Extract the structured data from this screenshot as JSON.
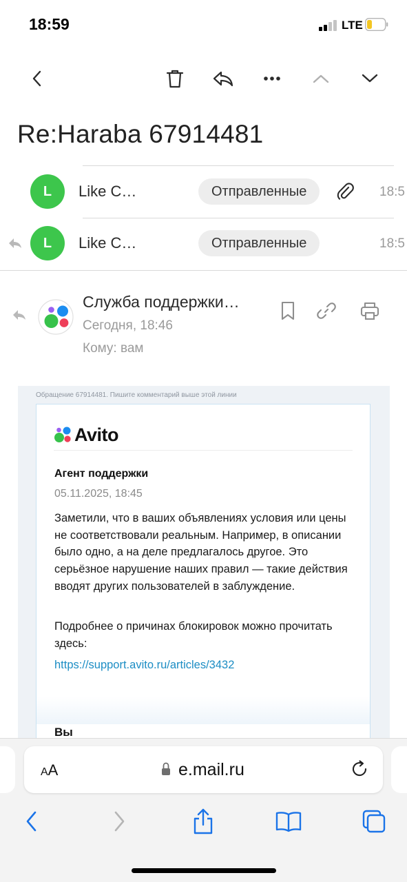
{
  "status_bar": {
    "time": "18:59",
    "network": "LTE",
    "battery_color": "#f3c623"
  },
  "toolbar": {
    "back_icon": "chevron-left-icon",
    "delete_icon": "trash-icon",
    "reply_icon": "reply-icon",
    "more_icon": "more-dots-icon",
    "prev_icon": "chevron-up-icon",
    "next_icon": "chevron-down-icon"
  },
  "email": {
    "subject": "Re:Haraba 67914481",
    "thread": [
      {
        "avatar_letter": "L",
        "name": "Like C…",
        "folder": "Отправленные",
        "time": "18:5",
        "has_attachment": true,
        "replied": false
      },
      {
        "avatar_letter": "L",
        "name": "Like C…",
        "folder": "Отправленные",
        "time": "18:5",
        "has_attachment": false,
        "replied": true
      }
    ],
    "open_message": {
      "sender": "Служба поддержки…",
      "date": "Сегодня, 18:46",
      "to": "Кому: вам",
      "actions": [
        "bookmark-icon",
        "link-icon",
        "print-icon"
      ]
    },
    "body": {
      "hint": "Обращение 67914481. Пишите комментарий выше этой линии",
      "logo_text": "Avito",
      "agent_label": "Агент поддержки",
      "message_date": "05.11.2025, 18:45",
      "paragraph1": "Заметили, что в ваших объявлениях условия или цены не соответствовали реальным. Например, в описании было одно, а на деле предлагалось другое. Это серьёзное нарушение наших правил — такие действия вводят других пользователей в заблуждение.",
      "paragraph2": "Подробнее о причинах блокировок можно прочитать здесь:",
      "link": "https://support.avito.ru/articles/3432",
      "next_author": "Вы"
    }
  },
  "browser": {
    "text_size_label": "AA",
    "url": "e.mail.ru",
    "nav": [
      "back-icon",
      "forward-icon",
      "share-icon",
      "bookmarks-icon",
      "tabs-icon"
    ],
    "accent": "#1a73e8"
  },
  "colors": {
    "avatar_green": "#3dc64c",
    "link_blue": "#1c8dc4"
  }
}
